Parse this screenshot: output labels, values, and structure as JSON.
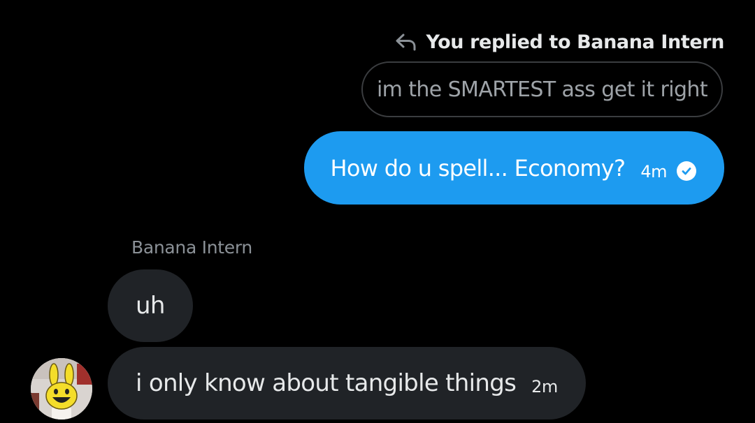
{
  "reply_header": {
    "text": "You replied to Banana Intern",
    "icon": "reply-arrow-icon"
  },
  "quoted_message": {
    "text": "im the SMARTEST ass get it right"
  },
  "sent_message": {
    "text": "How do u spell... Economy?",
    "time": "4m",
    "status_icon": "read-check-icon",
    "bubble_color": "#1d9bf0"
  },
  "conversation": {
    "sender_name": "Banana Intern",
    "messages": [
      {
        "text": "uh",
        "time": ""
      },
      {
        "text": "i only know about tangible things",
        "time": "2m"
      }
    ],
    "avatar_icon": "banana-bunny-avatar"
  },
  "colors": {
    "background": "#000000",
    "received_bubble": "#202327",
    "accent": "#1d9bf0"
  }
}
